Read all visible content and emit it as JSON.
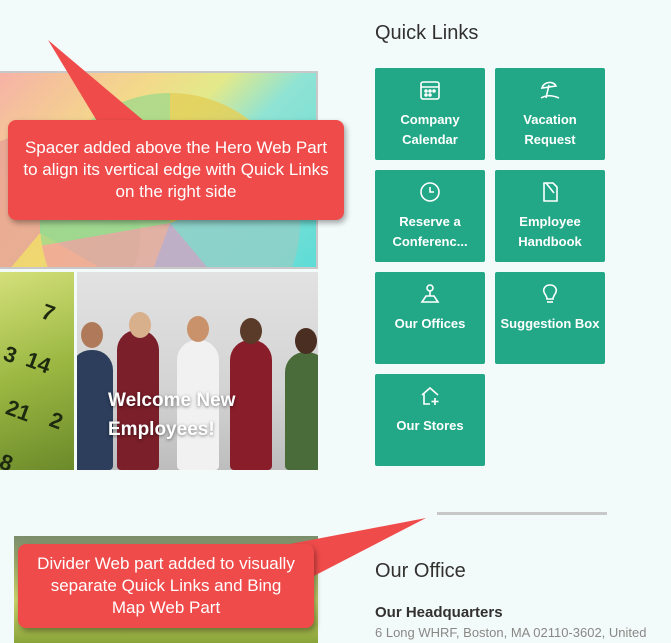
{
  "quick_links": {
    "title": "Quick Links",
    "tiles": [
      {
        "label": "Company Calendar",
        "icon": "calendar-icon"
      },
      {
        "label": "Vacation Request",
        "icon": "beach-umbrella-icon"
      },
      {
        "label": "Reserve a Conferenc...",
        "icon": "clock-icon"
      },
      {
        "label": "Employee Handbook",
        "icon": "document-icon"
      },
      {
        "label": "Our Offices",
        "icon": "map-pin-icon"
      },
      {
        "label": "Suggestion Box",
        "icon": "lightbulb-icon"
      },
      {
        "label": "Our Stores",
        "icon": "home-add-icon"
      }
    ],
    "tile_color": "#22a887"
  },
  "hero": {
    "caption": "Welcome New Employees!"
  },
  "office": {
    "title": "Our Office",
    "hq_title": "Our Headquarters",
    "hq_address": "6 Long WHRF, Boston, MA 02110-3602, United"
  },
  "callouts": {
    "spacer": "Spacer added above the Hero Web Part to align its vertical edge with Quick Links on the right side",
    "divider": "Divider Web part added to visually separate Quick Links and Bing Map Web Part",
    "color": "#f04b4b"
  }
}
